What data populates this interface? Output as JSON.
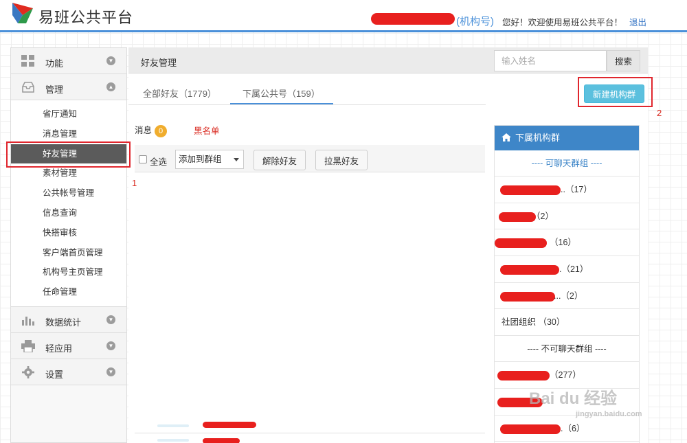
{
  "header": {
    "logo_text": "易班公共平台",
    "org_tag": "(机构号)",
    "welcome": "您好！欢迎使用易班公共平台！",
    "logout": "退出"
  },
  "sidebar": {
    "menus": [
      {
        "label": "功能",
        "icon": "grid-icon"
      },
      {
        "label": "管理",
        "icon": "inbox-icon"
      },
      {
        "label": "数据统计",
        "icon": "bar-chart-icon"
      },
      {
        "label": "轻应用",
        "icon": "printer-icon"
      },
      {
        "label": "设置",
        "icon": "gear-icon"
      }
    ],
    "sub_items": [
      "省厅通知",
      "消息管理",
      "好友管理",
      "素材管理",
      "公共帐号管理",
      "信息查询",
      "快搭审核",
      "客户端首页管理",
      "机构号主页管理",
      "任命管理"
    ],
    "active_sub": "好友管理"
  },
  "main": {
    "title": "好友管理",
    "search_placeholder": "输入姓名",
    "search_button": "搜索",
    "tabs": [
      {
        "label": "全部好友（1779）",
        "active": false
      },
      {
        "label": "下属公共号（159）",
        "active": true
      }
    ],
    "new_group_button": "新建机构群",
    "messages_label": "消息",
    "messages_count": "0",
    "blacklist_label": "黑名单",
    "select_all": "全选",
    "add_to_group": "添加到群组",
    "remove_friend": "解除好友",
    "block_friend": "拉黑好友"
  },
  "group_panel": {
    "title": "下属机构群",
    "chat_section": "---- 可聊天群组 ----",
    "nochat_section": "---- 不可聊天群组 ----",
    "chat_groups": [
      "..（17）",
      "（2）",
      "（16）",
      ".（21）",
      "...（2）",
      "社团组织 （30）"
    ],
    "nochat_groups": [
      "（277）",
      "",
      ".（6）"
    ]
  },
  "annotations": {
    "box1": "1",
    "box2": "2"
  },
  "watermark": {
    "brand": "Bai du 经验",
    "url": "jingyan.baidu.com"
  },
  "colors": {
    "accent": "#4a90d9",
    "panel_head": "#3e86c8",
    "cyan_button": "#5bc0de",
    "annotation": "#e0262d",
    "badge": "#f0ad2e"
  }
}
